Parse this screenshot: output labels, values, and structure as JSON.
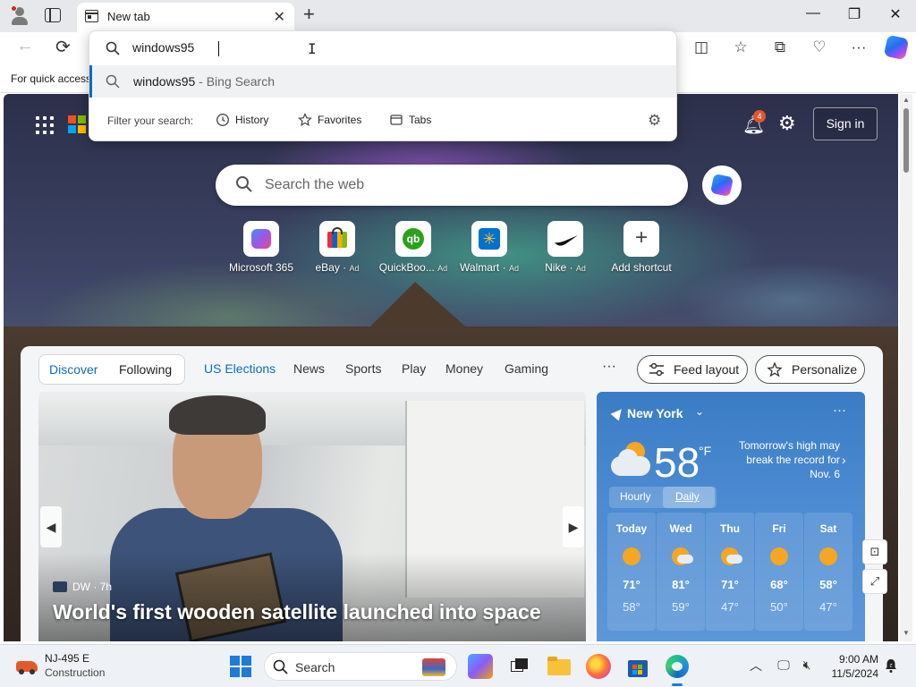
{
  "browser": {
    "tab_title": "New tab",
    "new_tab_symbol": "+",
    "close_symbol": "✕",
    "window_controls": {
      "minimize": "—",
      "restore": "❐",
      "close": "✕"
    }
  },
  "toolbar": {
    "back": "←",
    "refresh": "⟳",
    "split": "◫",
    "favorites": "☆",
    "collections": "⧉",
    "browser_essentials": "♡",
    "more": "···"
  },
  "favorites_bar": {
    "text": "For quick access"
  },
  "omnibox": {
    "value": "windows95",
    "suggestion_query": "windows95",
    "suggestion_source": " - Bing Search",
    "filter_label": "Filter your search:",
    "filters": [
      "History",
      "Favorites",
      "Tabs"
    ]
  },
  "ntp": {
    "notification_count": "4",
    "signin": "Sign in",
    "search_placeholder": "Search the web",
    "shortcuts": [
      {
        "label": "Microsoft 365",
        "ad": ""
      },
      {
        "label": "eBay",
        "ad": "Ad"
      },
      {
        "label": "QuickBoo...",
        "ad": "Ad"
      },
      {
        "label": "Walmart",
        "ad": "Ad"
      },
      {
        "label": "Nike",
        "ad": "Ad"
      },
      {
        "label": "Add shortcut",
        "ad": ""
      }
    ]
  },
  "feed": {
    "pills": [
      "Discover",
      "Following"
    ],
    "categories": [
      "US Elections",
      "News",
      "Sports",
      "Play",
      "Money",
      "Gaming"
    ],
    "more": "···",
    "feed_layout": "Feed layout",
    "personalize": "Personalize",
    "hero": {
      "source": "DW",
      "age": "7h",
      "title": "World's first wooden satellite launched into space"
    }
  },
  "weather": {
    "location": "New York",
    "temp": "58",
    "unit": "°F",
    "alert": "Tomorrow's high may break the record for Nov. 6",
    "toggle": [
      "Hourly",
      "Daily"
    ],
    "selected_toggle": "Daily",
    "days": [
      {
        "name": "Today",
        "hi": "71°",
        "lo": "58°",
        "icon": "sunny"
      },
      {
        "name": "Wed",
        "hi": "81°",
        "lo": "59°",
        "icon": "partly-cloudy"
      },
      {
        "name": "Thu",
        "hi": "71°",
        "lo": "47°",
        "icon": "partly-cloudy"
      },
      {
        "name": "Fri",
        "hi": "68°",
        "lo": "50°",
        "icon": "sunny"
      },
      {
        "name": "Sat",
        "hi": "58°",
        "lo": "47°",
        "icon": "sunny"
      }
    ]
  },
  "taskbar": {
    "traffic_title": "NJ-495 E",
    "traffic_sub": "Construction",
    "search_placeholder": "Search",
    "time": "9:00 AM",
    "date": "11/5/2024"
  },
  "colors": {
    "accent": "#0f6cbd",
    "weather_bg": "#4b8ad1",
    "taskbar_bg": "#eef1f6",
    "titlebar_bg": "#e6e8eb"
  }
}
